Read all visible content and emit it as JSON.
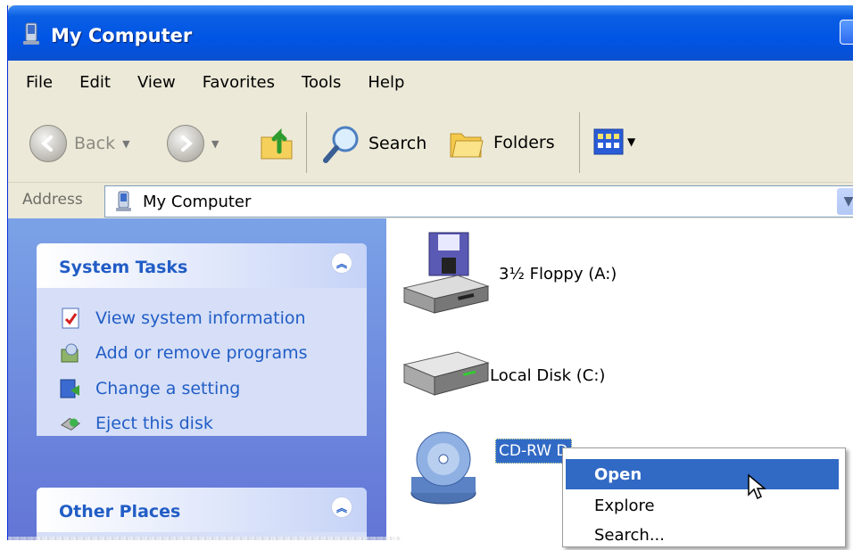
{
  "window": {
    "title": "My Computer"
  },
  "menubar": {
    "items": [
      "File",
      "Edit",
      "View",
      "Favorites",
      "Tools",
      "Help"
    ]
  },
  "toolbar": {
    "back_label": "Back",
    "search_label": "Search",
    "folders_label": "Folders"
  },
  "address": {
    "label": "Address",
    "value": "My Computer"
  },
  "system_tasks": {
    "title": "System Tasks",
    "items": [
      "View system information",
      "Add or remove programs",
      "Change a setting",
      "Eject this disk"
    ]
  },
  "other_places": {
    "title": "Other Places"
  },
  "drives": {
    "floppy": "3½ Floppy (A:)",
    "local": "Local Disk (C:)",
    "cdrw": "CD-RW D"
  },
  "context_menu": {
    "items": [
      "Open",
      "Explore",
      "Search..."
    ]
  },
  "colors": {
    "titlebar": "#0055e5",
    "selection": "#316ac5",
    "task_link": "#215dc6",
    "panel_bg": "#d6dff7"
  }
}
